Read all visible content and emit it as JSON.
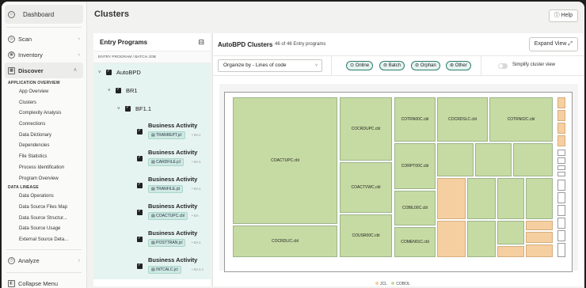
{
  "sidebar": {
    "dashboard": "Dashboard",
    "items": [
      {
        "label": "Scan"
      },
      {
        "label": "Inventory"
      },
      {
        "label": "Discover"
      }
    ],
    "section_app": "APPLICATION OVERVIEW",
    "app_items": [
      "App Overview",
      "Clusters",
      "Complexity Analysis",
      "Connections",
      "Data Dictionary",
      "Dependencies",
      "File Statistics",
      "Process Identification",
      "Program Overview"
    ],
    "section_lineage": "DATA LINEAGE",
    "lineage_items": [
      "Data Operations",
      "Data Source Files Map",
      "Data Source Structur...",
      "Data Source Usage",
      "External Source Deta..."
    ],
    "analyze": "Analyze",
    "collapse": "Collapse Menu"
  },
  "header": {
    "title": "Clusters",
    "help": "Help"
  },
  "entry": {
    "title": "Entry Programs",
    "column": "ENTRY PROGRAM / BATCH JOB",
    "tree": [
      "AutoBPD",
      "BR1",
      "BF1.1"
    ],
    "activities": [
      {
        "title": "Business Activity",
        "file": "TRANREPT.jcl",
        "more": "BA1"
      },
      {
        "title": "Business Activity",
        "file": "CARDFILE.jcl",
        "more": "BA1."
      },
      {
        "title": "Business Activity",
        "file": "TRANFILE.jcl",
        "more": "BA1."
      },
      {
        "title": "Business Activity",
        "file": "COACTUPC.cbl",
        "more": "BA"
      },
      {
        "title": "Business Activity",
        "file": "POSTTRAN.jcl",
        "more": "BA1"
      },
      {
        "title": "Business Activity",
        "file": "INTCALC.jcl",
        "more": "BA1.1"
      }
    ]
  },
  "clusters": {
    "title": "AutoBPD Clusters",
    "count": "46 of 46 Entry programs",
    "expand": "Expand View",
    "organize": "Organize by - Lines of code",
    "filters": [
      "Online",
      "Batch",
      "Orphan",
      "Other"
    ],
    "simplify": "Simplify cluster view",
    "labels": {
      "a": "COACTUPC.cbl",
      "b": "COCRDUPC.cbl",
      "c": "COTRN00C.cbl",
      "d": "COCRDSLC.cbl",
      "e": "COTRN02C.cbl",
      "f": "CORPT00C.cbl",
      "g": "COACTVWC.cbl",
      "h": "COBIL00C.cbl",
      "i": "COCRDLIC.cbl",
      "j": "COUSR00C.cbl",
      "k": "COMEN01C.cbl"
    },
    "legend": [
      "JCL",
      "COBOL"
    ],
    "colors": {
      "cobol": "#c6dba3",
      "jcl": "#f5cfa0",
      "accent": "#2f7d6d"
    }
  }
}
